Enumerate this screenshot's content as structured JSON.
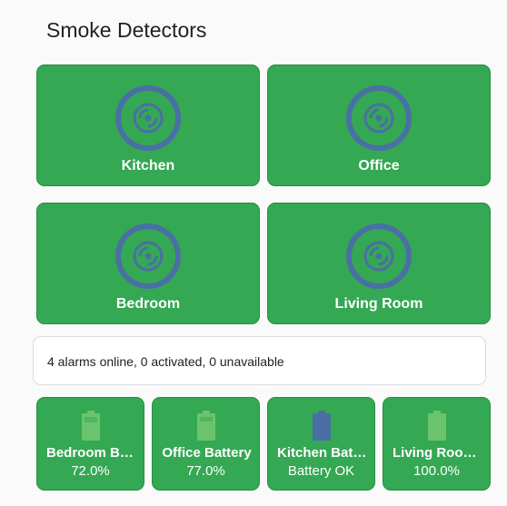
{
  "page": {
    "title": "Smoke Detectors"
  },
  "colors": {
    "card_green": "#34a853",
    "icon_blue": "#4a6fa5",
    "battery_light_green": "#6bc46d",
    "battery_ok_blue": "#4a6fa5"
  },
  "detectors": [
    {
      "name": "Kitchen",
      "icon": "smoke-detector-icon"
    },
    {
      "name": "Office",
      "icon": "smoke-detector-icon"
    },
    {
      "name": "Bedroom",
      "icon": "smoke-detector-icon"
    },
    {
      "name": "Living Room",
      "icon": "smoke-detector-icon"
    }
  ],
  "status": {
    "text": "4 alarms online, 0 activated, 0 unavailable"
  },
  "batteries": [
    {
      "name": "Bedroom Battery",
      "value": "72.0%",
      "level": 0.72,
      "icon": "battery-icon"
    },
    {
      "name": "Office Battery",
      "value": "77.0%",
      "level": 0.77,
      "icon": "battery-icon"
    },
    {
      "name": "Kitchen Battery",
      "value": "Battery OK",
      "level": 1.0,
      "icon": "battery-icon"
    },
    {
      "name": "Living Room Battery",
      "value": "100.0%",
      "level": 1.0,
      "icon": "battery-icon"
    }
  ]
}
